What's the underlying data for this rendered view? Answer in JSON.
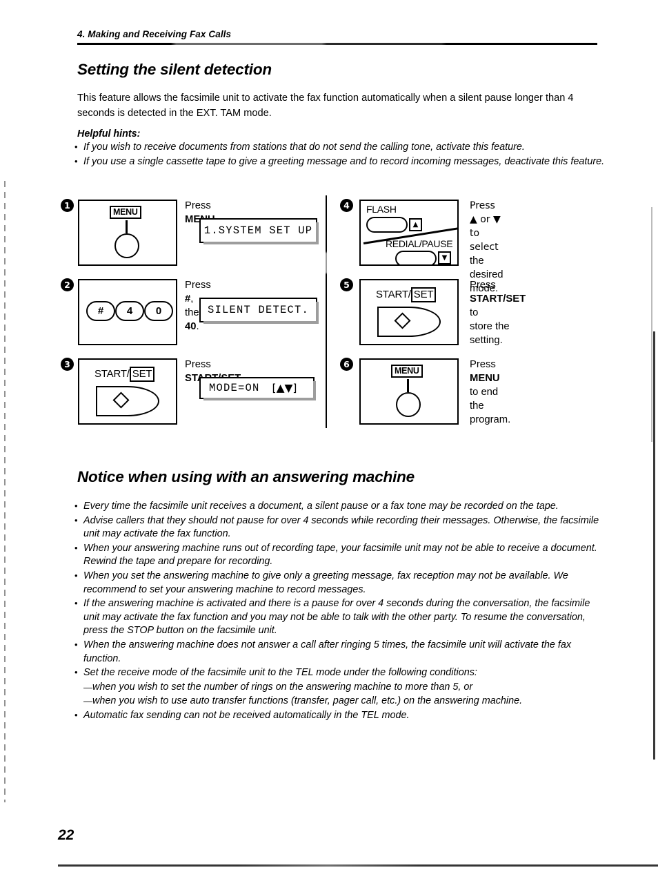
{
  "page": {
    "running_head": "4.  Making and Receiving Fax Calls",
    "page_number": "22"
  },
  "sections": {
    "silent_detection": {
      "title": "Setting the silent detection",
      "intro": "This feature allows the facsimile unit to activate the fax function automatically when a silent pause longer than 4 seconds is detected in the EXT. TAM mode.",
      "hints_label": "Helpful hints:",
      "hints": [
        "If you wish to receive documents from stations that do not send the calling tone, activate this feature.",
        "If you use a single cassette tape to give a greeting message and to record incoming messages, deactivate this feature."
      ]
    },
    "notice": {
      "title": "Notice when using with an answering machine",
      "bullets": [
        {
          "type": "bullet",
          "text": "Every time the facsimile unit receives a document, a silent pause or a fax tone may be recorded on the tape."
        },
        {
          "type": "bullet",
          "text": "Advise callers that they should not pause for over 4 seconds while recording their messages. Otherwise, the facsimile unit may activate the fax function."
        },
        {
          "type": "bullet",
          "text": "When your answering machine runs out of recording tape, your facsimile unit may not be able to receive a document. Rewind the tape and prepare for recording."
        },
        {
          "type": "bullet",
          "text": "When you set the answering machine to give only a greeting message, fax reception may not be available. We recommend to set your answering machine to record messages."
        },
        {
          "type": "bullet",
          "text": "If the answering machine is activated and there is a pause for over 4 seconds during the conversation, the facsimile unit may activate the fax function and you may not be able to talk with the other party. To resume the conversation, press the STOP button on the facsimile unit."
        },
        {
          "type": "bullet",
          "text": "When the answering machine does not answer a call after ringing 5 times, the facsimile unit will activate the fax function."
        },
        {
          "type": "bullet",
          "text": "Set the receive mode of the facsimile unit to the TEL mode under the following conditions:"
        },
        {
          "type": "sub",
          "text": "when you wish to set the number of rings on the answering machine to more than 5, or"
        },
        {
          "type": "sub",
          "text": "when you wish to use auto transfer functions (transfer, pager call, etc.) on the answering machine."
        },
        {
          "type": "bullet",
          "text": "Automatic fax sending can not be received automatically in the TEL mode."
        }
      ]
    }
  },
  "steps": [
    {
      "number": "1",
      "key_label": "MENU",
      "instruction_prefix": "Press ",
      "instruction_bold": "MENU",
      "instruction_suffix": ".",
      "lcd": "1.SYSTEM SET UP"
    },
    {
      "number": "2",
      "keys": [
        "#",
        "4",
        "0"
      ],
      "instruction_prefix": "Press ",
      "instruction_bold": "#",
      "instruction_mid": ", then ",
      "instruction_bold2": "40",
      "instruction_suffix": ".",
      "lcd": "SILENT DETECT."
    },
    {
      "number": "3",
      "key_label_start": "START/",
      "key_label_set": "SET",
      "instruction_prefix": "Press ",
      "instruction_bold": "START/SET",
      "instruction_suffix": ".",
      "lcd_left": "MODE=ON",
      "lcd_right": "[▲▼]"
    },
    {
      "number": "4",
      "key_flash": "FLASH",
      "key_redial": "REDIAL/PAUSE",
      "arrow_up": "▲",
      "arrow_down": "▼",
      "instruction_line1": "Press ▲ or ▼ to select",
      "instruction_line2": "the desired mode."
    },
    {
      "number": "5",
      "key_label_start": "START/",
      "key_label_set": "SET",
      "instruction_prefix": "Press ",
      "instruction_bold": "START/SET",
      "instruction_suffix": " to",
      "instruction_line2": "store the setting."
    },
    {
      "number": "6",
      "key_label": "MENU",
      "instruction_prefix": "Press ",
      "instruction_bold": "MENU",
      "instruction_suffix": " to end the",
      "instruction_line2": "program."
    }
  ]
}
